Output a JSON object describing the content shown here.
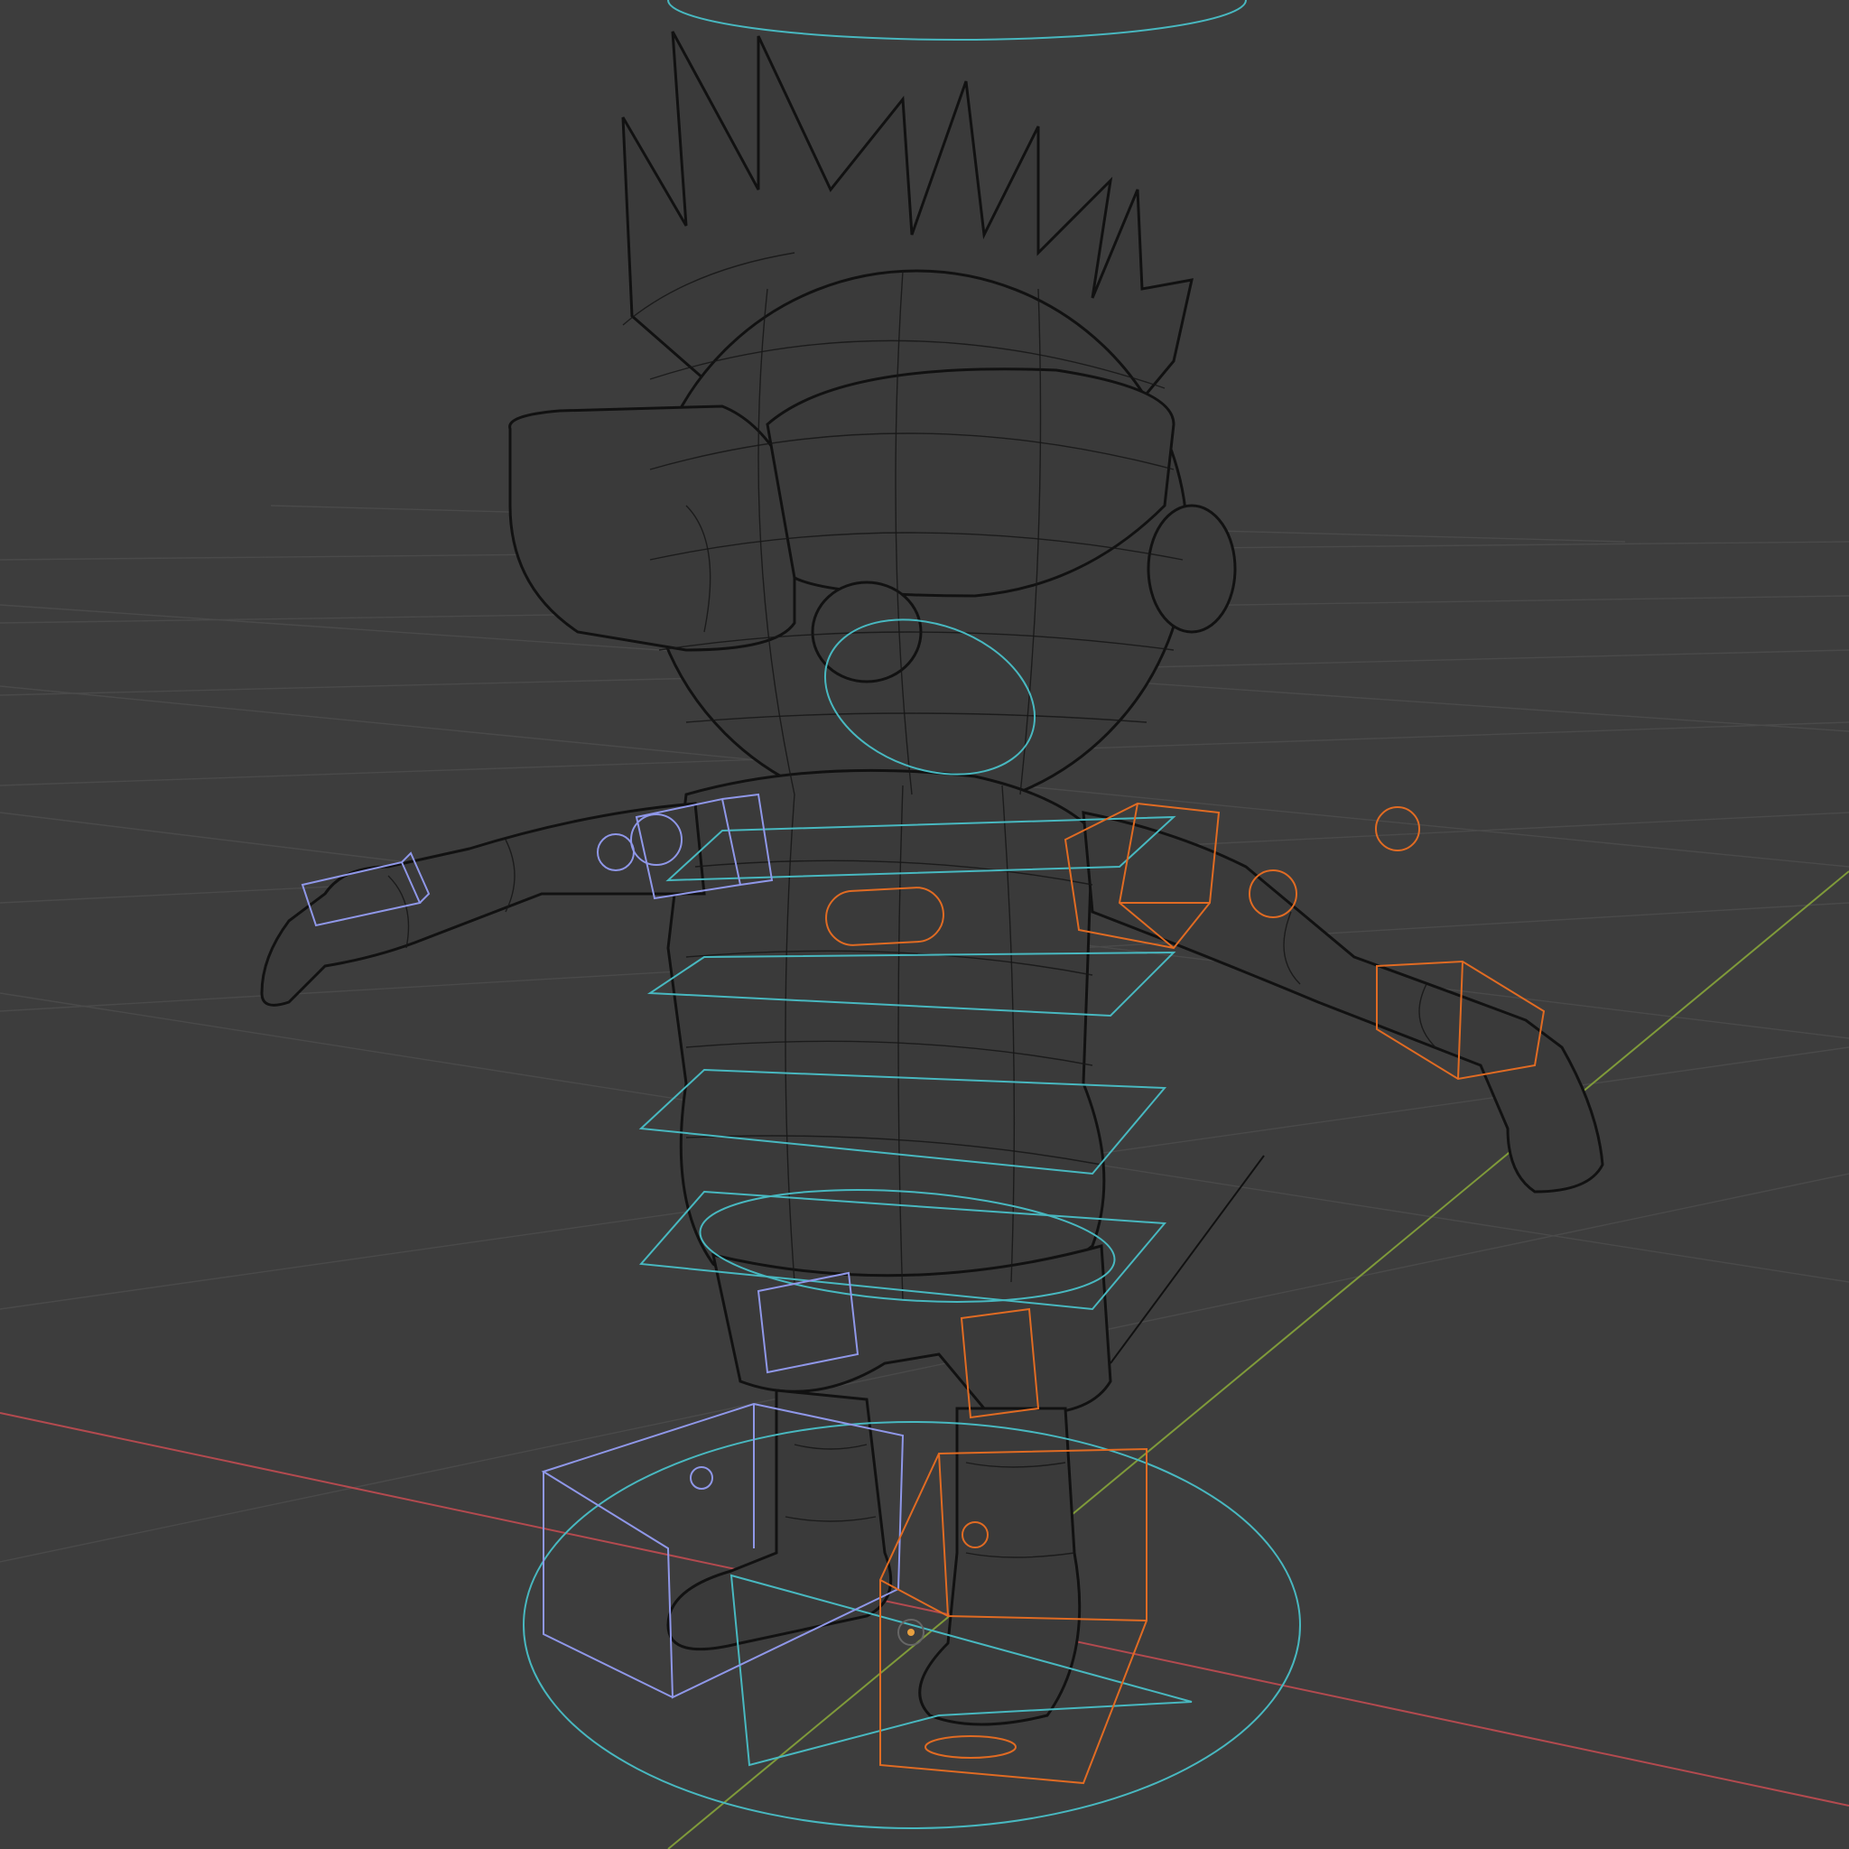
{
  "viewport": {
    "view": "3D Viewport",
    "shading": "wireframe",
    "background_color": "#3d3d3d",
    "grid_color": "#4a4a4a"
  },
  "axes": {
    "x_color": "#b34a4f",
    "y_color": "#7f9a3a"
  },
  "character": {
    "type": "cartoon-boy-mesh",
    "wire_color": "#111111"
  },
  "rig_controls": {
    "center_color": "#48b8c0",
    "left_color": "#8f97e8",
    "right_color": "#e06b23"
  }
}
